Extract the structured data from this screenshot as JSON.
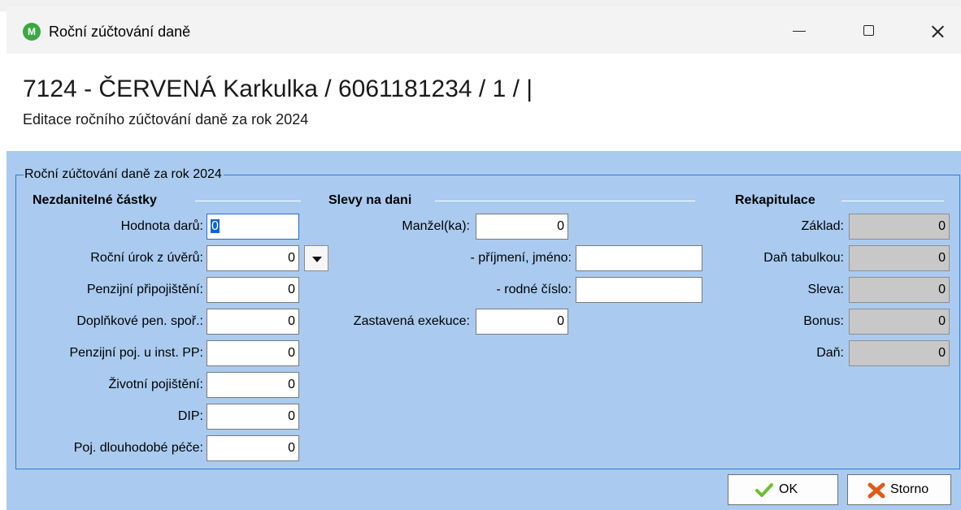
{
  "window": {
    "title": "Roční zúčtování daně",
    "app_icon_letter": "M"
  },
  "header": {
    "title": "7124 - ČERVENÁ Karkulka / 6061181234 / 1 /  |",
    "subtitle": "Editace ročního zúčtování daně za rok 2024"
  },
  "group": {
    "legend": "Roční zúčtování daně za rok 2024"
  },
  "nezdanitelne": {
    "heading": "Nezdanitelné částky",
    "fields": [
      {
        "label": "Hodnota darů:",
        "value": "0"
      },
      {
        "label": "Roční úrok z úvěrů:",
        "value": "0"
      },
      {
        "label": "Penzijní připojištění:",
        "value": "0"
      },
      {
        "label": "Doplňkové pen. spoř.:",
        "value": "0"
      },
      {
        "label": "Penzijní poj. u inst. PP:",
        "value": "0"
      },
      {
        "label": "Životní pojištění:",
        "value": "0"
      },
      {
        "label": "DIP:",
        "value": "0"
      },
      {
        "label": "Poj. dlouhodobé péče:",
        "value": "0"
      }
    ]
  },
  "slevy": {
    "heading": "Slevy na dani",
    "spouse_label": "Manžel(ka):",
    "spouse_value": "0",
    "surname_label": "- příjmení, jméno:",
    "surname_value": "",
    "birth_label": "- rodné číslo:",
    "birth_value": "",
    "exekuce_label": "Zastavená exekuce:",
    "exekuce_value": "0"
  },
  "rekapitulace": {
    "heading": "Rekapitulace",
    "fields": [
      {
        "label": "Základ:",
        "value": "0"
      },
      {
        "label": "Daň tabulkou:",
        "value": "0"
      },
      {
        "label": "Sleva:",
        "value": "0"
      },
      {
        "label": "Bonus:",
        "value": "0"
      },
      {
        "label": "Daň:",
        "value": "0"
      }
    ]
  },
  "buttons": {
    "ok": "OK",
    "storno": "Storno"
  },
  "colors": {
    "content_bg": "#aacbef",
    "group_border": "#2f7bd1",
    "ok_check": "#6fbf2f",
    "storno_x": "#e05a17"
  }
}
